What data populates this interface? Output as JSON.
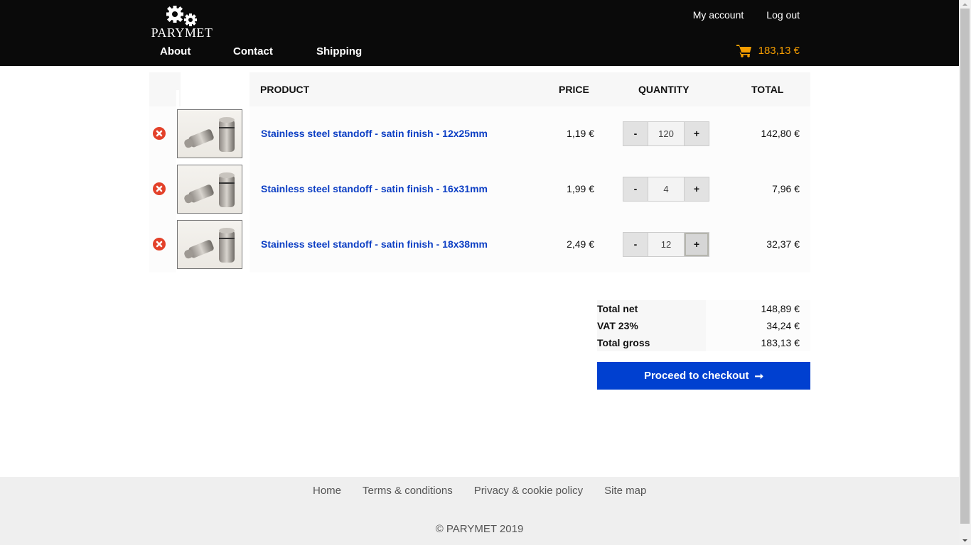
{
  "header": {
    "logo_text": "PARYMET",
    "top_links": [
      "My account",
      "Log out"
    ],
    "nav": [
      "About",
      "Contact",
      "Shipping"
    ],
    "cart_total": "183,13 €",
    "cart_icon": "shopping-cart-icon",
    "cart_color": "#f59d00"
  },
  "cart": {
    "columns": {
      "product": "PRODUCT",
      "price": "PRICE",
      "quantity": "QUANTITY",
      "total": "TOTAL"
    },
    "qty_minus": "-",
    "qty_plus": "+",
    "items": [
      {
        "name": "Stainless steel standoff - satin finish - 12x25mm",
        "price": "1,19 €",
        "quantity": "120",
        "total": "142,80 €"
      },
      {
        "name": "Stainless steel standoff - satin finish - 16x31mm",
        "price": "1,99 €",
        "quantity": "4",
        "total": "7,96 €"
      },
      {
        "name": "Stainless steel standoff - satin finish - 18x38mm",
        "price": "2,49 €",
        "quantity": "12",
        "total": "32,37 €"
      }
    ]
  },
  "summary": {
    "rows": [
      {
        "label": "Total net",
        "value": "148,89 €"
      },
      {
        "label": "VAT 23%",
        "value": "34,24 €"
      },
      {
        "label": "Total gross",
        "value": "183,13 €"
      }
    ],
    "checkout_label": "Proceed to checkout",
    "checkout_arrow": "➞",
    "checkout_color": "#0040d0"
  },
  "footer": {
    "links": [
      "Home",
      "Terms & conditions",
      "Privacy & cookie policy",
      "Site map"
    ],
    "copyright": "© PARYMET 2019"
  }
}
